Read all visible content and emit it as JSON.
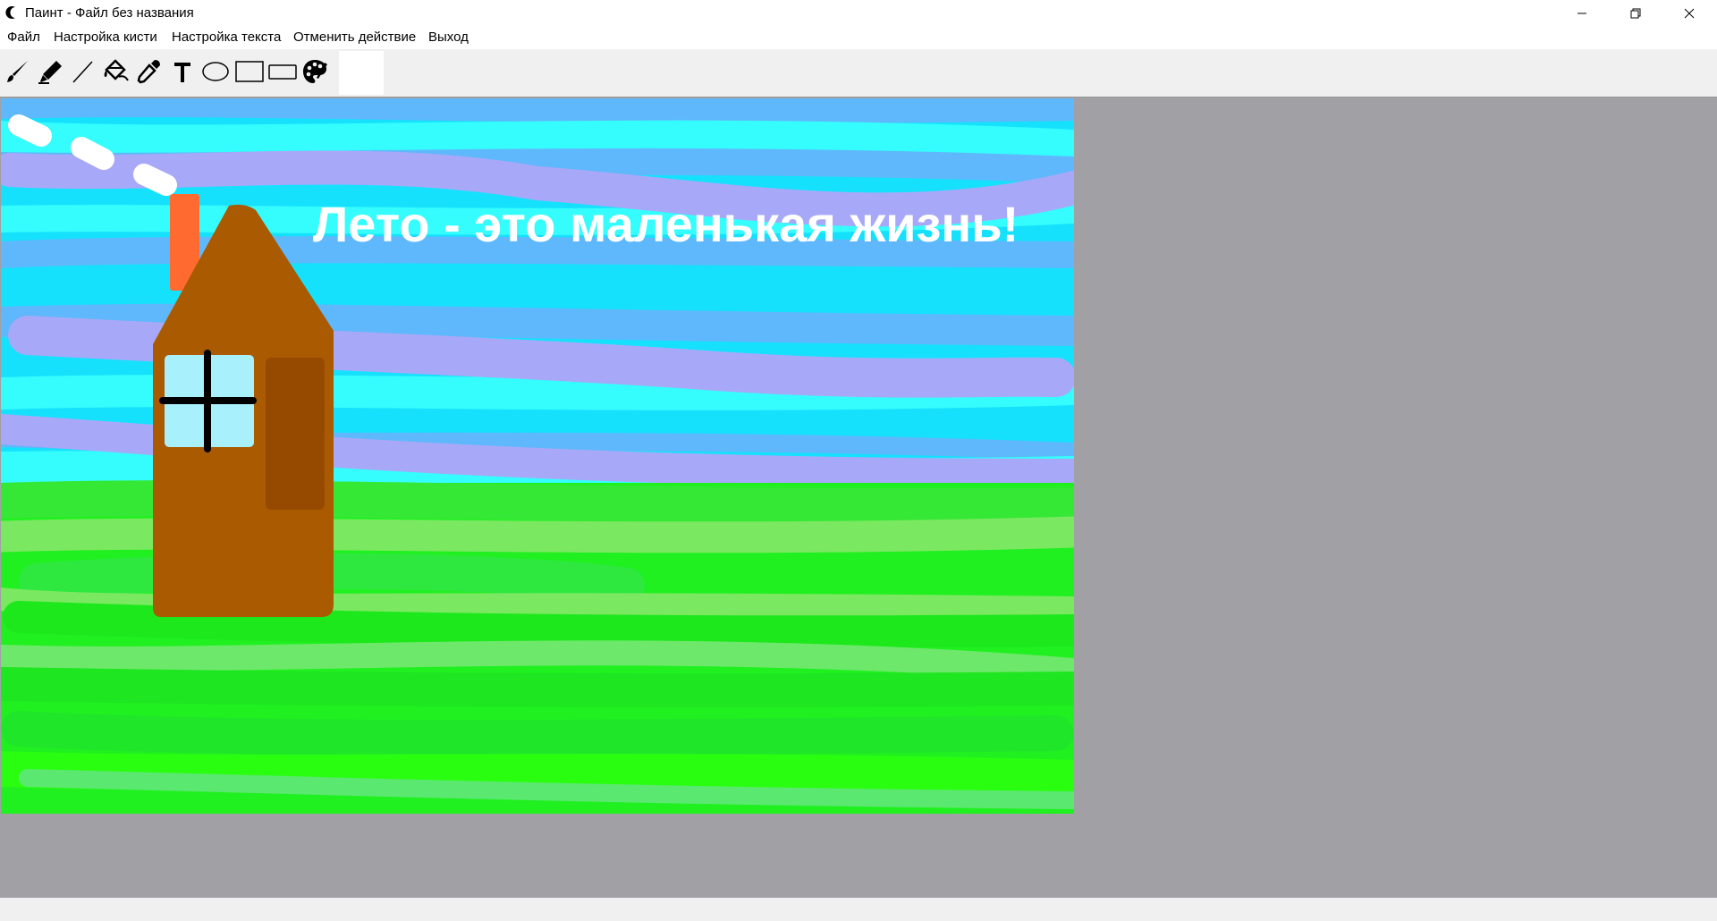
{
  "window": {
    "title": "Паинт - Файл без названия",
    "app_icon": "crescent-icon",
    "controls": [
      "minimize-icon",
      "restore-icon",
      "close-icon"
    ]
  },
  "menu": {
    "file": "Файл",
    "brush_settings": "Настройка кисти",
    "text_settings": "Настройка текста",
    "undo": "Отменить действие",
    "exit": "Выход"
  },
  "toolbar": {
    "tools": [
      "brush-icon",
      "marker-icon",
      "line-icon",
      "fill-bucket-icon",
      "eyedropper-icon",
      "text-tool-icon",
      "ellipse-icon",
      "rectangle-icon",
      "rounded-rectangle-icon",
      "palette-icon"
    ],
    "current_color": "#ffffff"
  },
  "canvas": {
    "text": "Лето - это маленькая жизнь!",
    "colors": {
      "sky": "#16e1fd",
      "sky_light": "#35fdfd",
      "blue_stroke": "#5fb8fb",
      "violet_stroke": "#a8a8f8",
      "grass": "#20f020",
      "grass_light": "#7ae860",
      "house": "#aa5a00",
      "door": "#964a00",
      "chimney": "#ff6a30",
      "window": "#a8f0fc",
      "text": "#ffffff"
    }
  },
  "colors": {
    "workspace": "#a1a0a4",
    "toolbar": "#f0f0f0"
  }
}
